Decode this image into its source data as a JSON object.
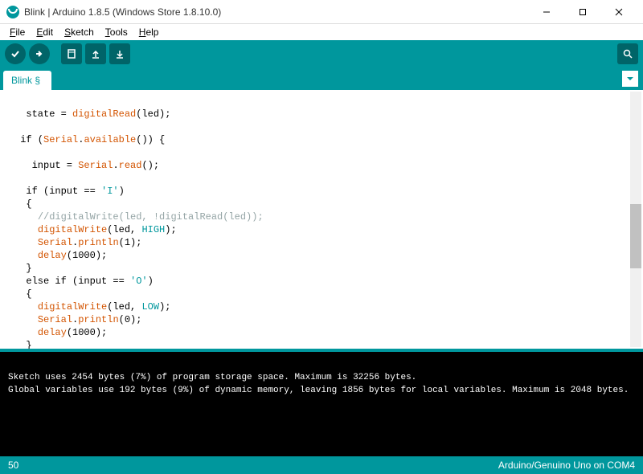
{
  "window": {
    "title": "Blink | Arduino 1.8.5 (Windows Store 1.8.10.0)"
  },
  "menu": {
    "file": "File",
    "edit": "Edit",
    "sketch": "Sketch",
    "tools": "Tools",
    "help": "Help"
  },
  "tab": {
    "name": "Blink §"
  },
  "code": {
    "line1_a": "  state = ",
    "line1_b": "digitalRead",
    "line1_c": "(led);",
    "line2_a": " ",
    "line3_a": " if (",
    "line3_b": "Serial",
    "line3_c": ".",
    "line3_d": "available",
    "line3_e": "()) {",
    "line4_a": " ",
    "line5_a": "   input = ",
    "line5_b": "Serial",
    "line5_c": ".",
    "line5_d": "read",
    "line5_e": "();",
    "line6_a": " ",
    "line7_a": "  if (input == ",
    "line7_b": "'I'",
    "line7_c": ")",
    "line8_a": "  {",
    "line9_a": "    ",
    "line9_b": "//digitalWrite(led, !digitalRead(led));",
    "line10_a": "    ",
    "line10_b": "digitalWrite",
    "line10_c": "(led, ",
    "line10_d": "HIGH",
    "line10_e": ");",
    "line11_a": "    ",
    "line11_b": "Serial",
    "line11_c": ".",
    "line11_d": "println",
    "line11_e": "(1);",
    "line12_a": "    ",
    "line12_b": "delay",
    "line12_c": "(1000);",
    "line13_a": "  }",
    "line14_a": "  else if (input == ",
    "line14_b": "'O'",
    "line14_c": ")",
    "line15_a": "  {",
    "line16_a": "    ",
    "line16_b": "digitalWrite",
    "line16_c": "(led, ",
    "line16_d": "LOW",
    "line16_e": ");",
    "line17_a": "    ",
    "line17_b": "Serial",
    "line17_c": ".",
    "line17_d": "println",
    "line17_e": "(0);",
    "line18_a": "    ",
    "line18_b": "delay",
    "line18_c": "(1000);",
    "line19_a": "  }"
  },
  "console": {
    "line1": "Sketch uses 2454 bytes (7%) of program storage space. Maximum is 32256 bytes.",
    "line2": "Global variables use 192 bytes (9%) of dynamic memory, leaving 1856 bytes for local variables. Maximum is 2048 bytes."
  },
  "status": {
    "line": "50",
    "board": "Arduino/Genuino Uno on COM4"
  }
}
